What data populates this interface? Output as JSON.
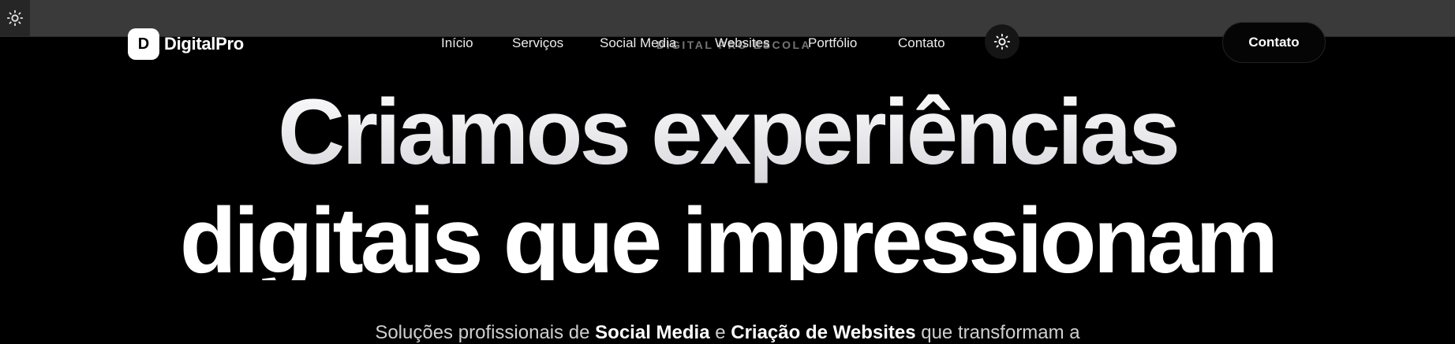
{
  "header": {
    "corner_toggle_icon": "sun-icon",
    "brand_letter": "D",
    "brand_name": "DigitalPro",
    "nav": [
      "Início",
      "Serviços",
      "Social Media",
      "Websites",
      "Portfólio",
      "Contato"
    ],
    "ghost_label": "DIGITAL PRO ESCOLA",
    "theme_toggle_icon": "sun-icon",
    "contact_button": "Contato"
  },
  "hero": {
    "title_line_1": "Criamos experiências",
    "title_line_2": "digitais que impressionam",
    "subtitle_prefix": "Soluções profissionais de ",
    "subtitle_bold_1": "Social Media",
    "subtitle_mid": " e ",
    "subtitle_bold_2": "Criação de Websites",
    "subtitle_suffix": " que transformam a"
  },
  "colors": {
    "background": "#000000",
    "topbar": "#3a3a3a",
    "text": "#ffffff"
  }
}
